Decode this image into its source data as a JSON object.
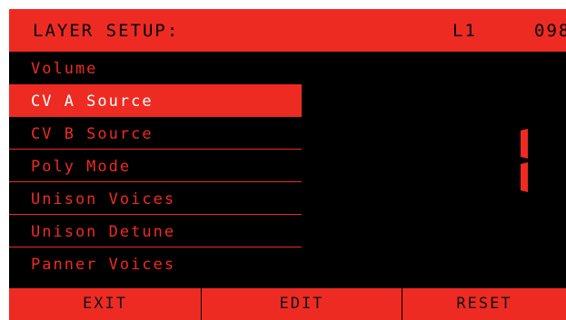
{
  "header": {
    "title": "LAYER SETUP:",
    "layer": "L1",
    "number": "098"
  },
  "menu": {
    "items": [
      {
        "label": "Volume"
      },
      {
        "label": "CV A Source"
      },
      {
        "label": "CV B Source"
      },
      {
        "label": "Poly Mode"
      },
      {
        "label": "Unison Voices"
      },
      {
        "label": "Unison Detune"
      },
      {
        "label": "Panner Voices"
      }
    ],
    "selected_index": 1
  },
  "value_display": {
    "digit": "1"
  },
  "softkeys": {
    "exit": "EXIT",
    "edit": "EDIT",
    "reset": "RESET"
  },
  "colors": {
    "accent": "#ee2b23",
    "background": "#000000"
  }
}
